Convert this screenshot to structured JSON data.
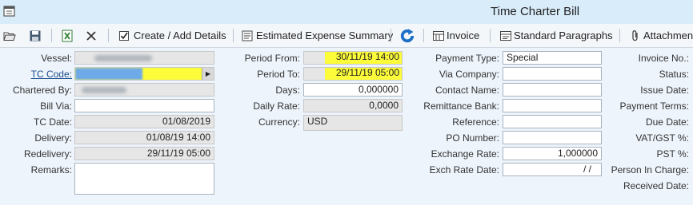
{
  "window": {
    "title": "Time Charter Bill"
  },
  "toolbar": {
    "create_add_details": "Create / Add Details",
    "estimated_expense_summary": "Estimated Expense Summary",
    "invoice": "Invoice",
    "standard_paragraphs": "Standard Paragraphs",
    "attachments": "Attachment"
  },
  "left": {
    "vessel_label": "Vessel:",
    "tc_code_label": "TC Code:",
    "chartered_by_label": "Chartered By:",
    "bill_via_label": "Bill Via:",
    "tc_date_label": "TC Date:",
    "tc_date_value": "01/08/2019",
    "delivery_label": "Delivery:",
    "delivery_value": "01/08/19  14:00",
    "redelivery_label": "Redelivery:",
    "redelivery_value": "29/11/19  05:00",
    "remarks_label": "Remarks:"
  },
  "middle": {
    "period_from_label": "Period From:",
    "period_from_value": "30/11/19  14:00",
    "period_to_label": "Period To:",
    "period_to_value": "29/11/19  05:00",
    "days_label": "Days:",
    "days_value": "0,000000",
    "daily_rate_label": "Daily Rate:",
    "daily_rate_value": "0,0000",
    "currency_label": "Currency:",
    "currency_value": "USD"
  },
  "right": {
    "payment_type_label": "Payment Type:",
    "payment_type_value": "Special",
    "via_company_label": "Via Company:",
    "contact_name_label": "Contact Name:",
    "remittance_bank_label": "Remittance Bank:",
    "reference_label": "Reference:",
    "po_number_label": "PO Number:",
    "exchange_rate_label": "Exchange Rate:",
    "exchange_rate_value": "1,000000",
    "exch_rate_date_label": "Exch Rate Date:",
    "exch_rate_date_value": "/ /"
  },
  "far_right": {
    "invoice_no_label": "Invoice No.:",
    "status_label": "Status:",
    "issue_date_label": "Issue Date:",
    "payment_terms_label": "Payment Terms:",
    "due_date_label": "Due Date:",
    "vat_gst_label": "VAT/GST %:",
    "pst_label": "PST %:",
    "person_in_charge_label": "Person In Charge:",
    "received_date_label": "Received Date:"
  },
  "colors": {
    "highlight": "#fcfc3a",
    "titlebar": "#d9ecfa",
    "accent_blue": "#1e6fc7"
  }
}
